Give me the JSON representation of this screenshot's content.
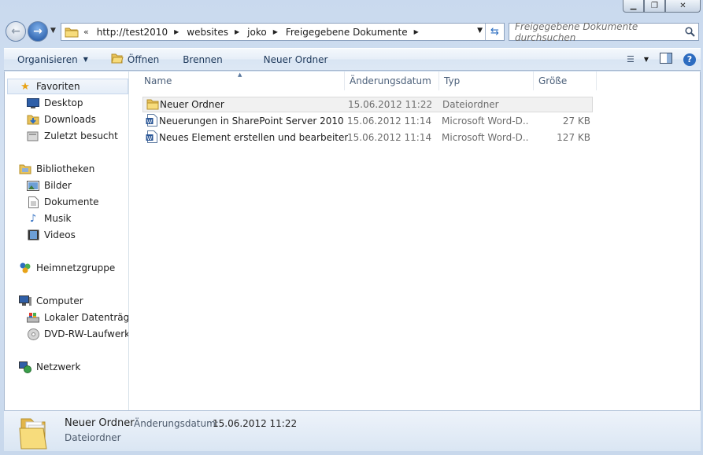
{
  "address": {
    "history_glyph": "«",
    "crumbs": [
      "http://test2010",
      "websites",
      "joko",
      "Freigegebene Dokumente"
    ]
  },
  "search": {
    "placeholder": "Freigegebene Dokumente durchsuchen"
  },
  "toolbar": {
    "organize": "Organisieren",
    "open": "Öffnen",
    "burn": "Brennen",
    "new_folder": "Neuer Ordner"
  },
  "nav_pane": {
    "favorites": "Favoriten",
    "desktop": "Desktop",
    "downloads": "Downloads",
    "recent": "Zuletzt besucht",
    "libraries": "Bibliotheken",
    "pictures": "Bilder",
    "documents": "Dokumente",
    "music": "Musik",
    "videos": "Videos",
    "homegroup": "Heimnetzgruppe",
    "computer": "Computer",
    "local_disk": "Lokaler Datenträger",
    "dvd_drive": "DVD-RW-Laufwerk (",
    "network": "Netzwerk"
  },
  "columns": {
    "name": "Name",
    "modified": "Änderungsdatum",
    "type": "Typ",
    "size": "Größe"
  },
  "files": [
    {
      "name": "Neuer Ordner",
      "modified": "15.06.2012 11:22",
      "type": "Dateiordner",
      "size": ""
    },
    {
      "name": "Neuerungen in SharePoint Server 2010",
      "modified": "15.06.2012 11:14",
      "type": "Microsoft Word-D...",
      "size": "27 KB"
    },
    {
      "name": "Neues Element erstellen und bearbeiten",
      "modified": "15.06.2012 11:14",
      "type": "Microsoft Word-D...",
      "size": "127 KB"
    }
  ],
  "details": {
    "name": "Neuer Ordner",
    "date_label": "Änderungsdatum:",
    "date": "15.06.2012 11:22",
    "type": "Dateiordner"
  },
  "colors": {
    "accent": "#1e395b",
    "selection": "#e4edf8"
  }
}
